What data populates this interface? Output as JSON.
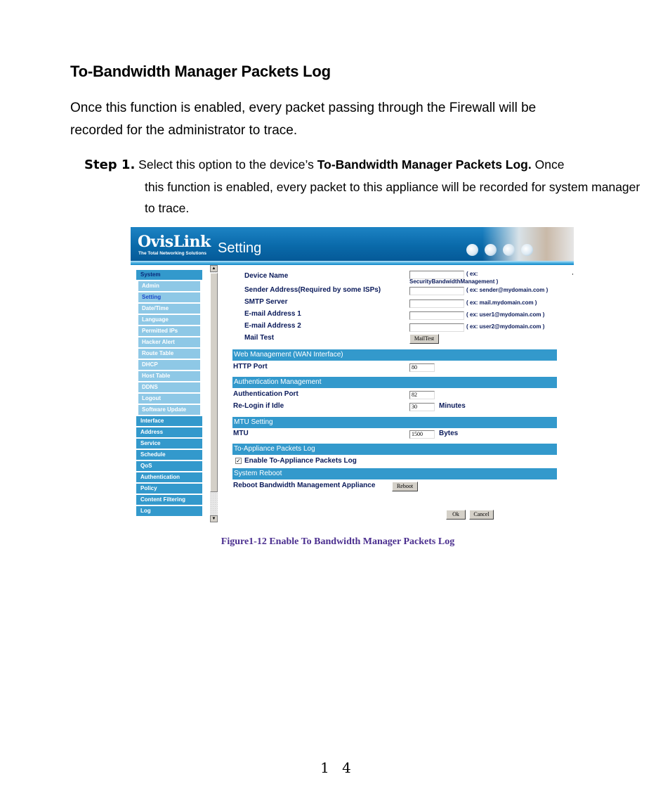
{
  "document": {
    "heading": "To-Bandwidth Manager Packets Log",
    "intro": "Once this function is enabled, every packet passing through the Firewall will be recorded for the administrator to trace.",
    "step": {
      "label": "Step 1.",
      "text_before": "Select this option to the device’s ",
      "text_bold": "To-Bandwidth Manager Packets Log.",
      "text_after": " Once",
      "continuation": "this function is enabled, every packet to this appliance will be recorded for system manager to trace."
    },
    "caption": "Figure1-12 Enable To Bandwidth Manager Packets Log",
    "page_number": "14"
  },
  "screenshot": {
    "banner": {
      "logo": "OvisLink",
      "tagline": "The Total Networking Solutions",
      "title": "Setting"
    },
    "sidebar": {
      "header": "System",
      "sub_items": [
        {
          "label": "Admin",
          "active": false
        },
        {
          "label": "Setting",
          "active": true
        },
        {
          "label": "Date/Time",
          "active": false
        },
        {
          "label": "Language",
          "active": false
        },
        {
          "label": "Permitted IPs",
          "active": false
        },
        {
          "label": "Hacker Alert",
          "active": false
        },
        {
          "label": "Route Table",
          "active": false
        },
        {
          "label": "DHCP",
          "active": false
        },
        {
          "label": "Host Table",
          "active": false
        },
        {
          "label": "DDNS",
          "active": false
        },
        {
          "label": "Logout",
          "active": false
        },
        {
          "label": "Software Update",
          "active": false
        }
      ],
      "main_items": [
        "Interface",
        "Address",
        "Service",
        "Schedule",
        "QoS",
        "Authentication",
        "Policy",
        "Content Filtering",
        "Log"
      ]
    },
    "form": {
      "device_name": {
        "label": "Device Name",
        "value": "",
        "hint_line1": "( ex:",
        "hint_line2": "SecurityBandwidthManagement )"
      },
      "sender_address": {
        "label": "Sender Address(Required by some ISPs)",
        "value": "",
        "hint": "( ex: sender@mydomain.com )"
      },
      "smtp_server": {
        "label": "SMTP Server",
        "value": "",
        "hint": "( ex: mail.mydomain.com )"
      },
      "email1": {
        "label": "E-mail Address 1",
        "value": "",
        "hint": "( ex: user1@mydomain.com )"
      },
      "email2": {
        "label": "E-mail Address 2",
        "value": "",
        "hint": "( ex: user2@mydomain.com )"
      },
      "mail_test": {
        "label": "Mail Test",
        "button": "MailTest"
      },
      "web_mgmt_section": "Web Management (WAN Interface)",
      "http_port": {
        "label": "HTTP Port",
        "value": "80"
      },
      "auth_section": "Authentication Management",
      "auth_port": {
        "label": "Authentication Port",
        "value": "82"
      },
      "relogin": {
        "label": "Re-Login if Idle",
        "value": "30",
        "unit": "Minutes"
      },
      "mtu_section": "MTU Setting",
      "mtu": {
        "label": "MTU",
        "value": "1500",
        "unit": "Bytes"
      },
      "packets_log_section": "To-Appliance Packets Log",
      "packets_log": {
        "label": "Enable To-Appliance Packets Log",
        "checked": true,
        "check_glyph": "✓"
      },
      "reboot_section": "System Reboot",
      "reboot": {
        "label": "Reboot Bandwidth Management Appliance",
        "button": "Reboot"
      },
      "ok_button": "Ok",
      "cancel_button": "Cancel"
    },
    "scrollbar": {
      "up_glyph": "▲",
      "down_glyph": "▼"
    }
  }
}
